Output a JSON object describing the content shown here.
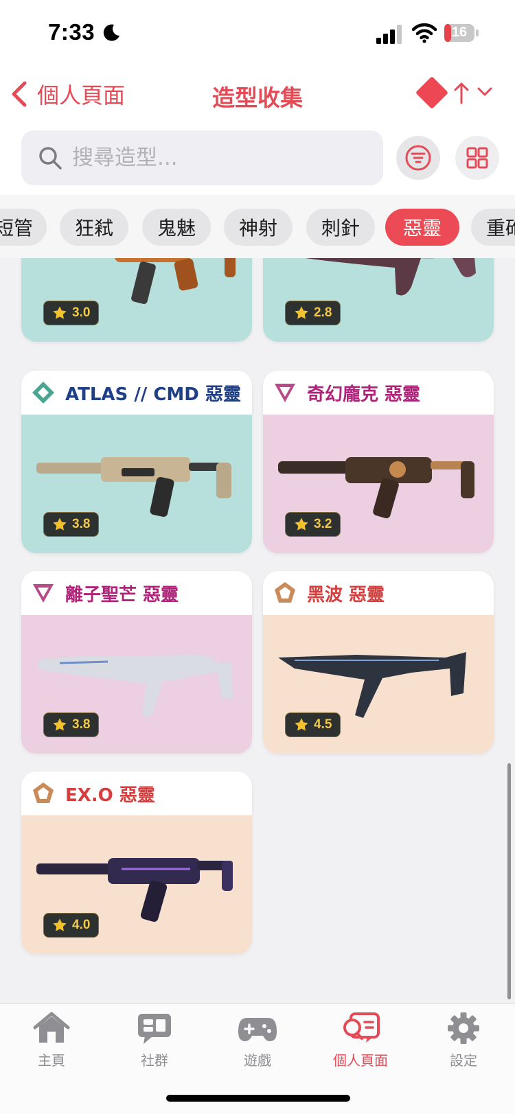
{
  "status": {
    "time": "7:33",
    "battery": "16"
  },
  "nav": {
    "back_label": "個人頁面",
    "title": "造型收集"
  },
  "search": {
    "placeholder": "搜尋造型..."
  },
  "chips": [
    "短管",
    "狂弒",
    "鬼魅",
    "神射",
    "刺針",
    "惡靈",
    "重砲"
  ],
  "active_chip": "惡靈",
  "cards": [
    {
      "title": "",
      "rating": "3.0",
      "bg": "teal",
      "rarity": "",
      "title_color": ""
    },
    {
      "title": "",
      "rating": "2.8",
      "bg": "teal",
      "rarity": "",
      "title_color": ""
    },
    {
      "title": "ATLAS // CMD 惡靈",
      "rating": "3.8",
      "bg": "teal",
      "rarity": "select",
      "title_color": "#1f3f86"
    },
    {
      "title": "奇幻龐克 惡靈",
      "rating": "3.2",
      "bg": "pink",
      "rarity": "premium",
      "title_color": "#b0237a"
    },
    {
      "title": "離子聖芒 惡靈",
      "rating": "3.8",
      "bg": "pink",
      "rarity": "premium",
      "title_color": "#b0237a"
    },
    {
      "title": "黑波 惡靈",
      "rating": "4.5",
      "bg": "peach",
      "rarity": "deluxe",
      "title_color": "#d43f3f"
    },
    {
      "title": "EX.O 惡靈",
      "rating": "4.0",
      "bg": "peach",
      "rarity": "deluxe",
      "title_color": "#d43f3f"
    }
  ],
  "tabs": [
    {
      "label": "主頁",
      "icon": "home-icon",
      "active": false
    },
    {
      "label": "社群",
      "icon": "chat-icon",
      "active": false
    },
    {
      "label": "遊戲",
      "icon": "gamepad-icon",
      "active": false
    },
    {
      "label": "個人頁面",
      "icon": "profile-search-icon",
      "active": true
    },
    {
      "label": "設定",
      "icon": "gear-icon",
      "active": false
    }
  ],
  "colors": {
    "accent": "#e34b57",
    "teal": "#b7dfdb",
    "pink": "#eccfe0",
    "peach": "#f8e0cf"
  }
}
